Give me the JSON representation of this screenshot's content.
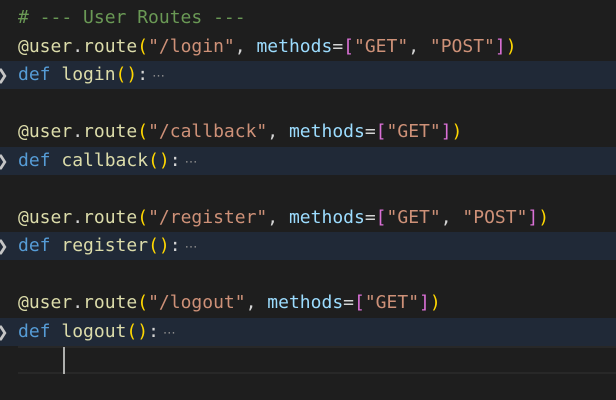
{
  "editor": {
    "language": "python",
    "colors": {
      "background": "#1e1e1e",
      "folded_line_background": "#202937",
      "comment": "#6a9955",
      "decorator": "#dcdcaa",
      "keyword": "#569cd6",
      "string": "#ce9178",
      "parameter": "#9cdcfe",
      "bracket_level1": "#ffd700",
      "bracket_level2": "#da70d6"
    },
    "fold_icon": "chevron-right-icon",
    "fold_placeholder": "⋯",
    "lines": [
      {
        "kind": "comment",
        "tokens": [
          {
            "t": "# --- User Routes ---",
            "c": "tk-comment"
          }
        ]
      },
      {
        "kind": "decorator",
        "tokens": [
          {
            "t": "@user",
            "c": "tk-deco"
          },
          {
            "t": ".",
            "c": "tk-plain"
          },
          {
            "t": "route",
            "c": "tk-deco"
          },
          {
            "t": "(",
            "c": "tk-br1"
          },
          {
            "t": "\"/login\"",
            "c": "tk-str"
          },
          {
            "t": ", ",
            "c": "tk-plain"
          },
          {
            "t": "methods",
            "c": "tk-param"
          },
          {
            "t": "=",
            "c": "tk-plain"
          },
          {
            "t": "[",
            "c": "tk-br2"
          },
          {
            "t": "\"GET\"",
            "c": "tk-str"
          },
          {
            "t": ", ",
            "c": "tk-plain"
          },
          {
            "t": "\"POST\"",
            "c": "tk-str"
          },
          {
            "t": "]",
            "c": "tk-br2"
          },
          {
            "t": ")",
            "c": "tk-br1"
          }
        ]
      },
      {
        "kind": "def",
        "folded": true,
        "tokens": [
          {
            "t": "def",
            "c": "tk-kw"
          },
          {
            "t": " ",
            "c": "tk-plain"
          },
          {
            "t": "login",
            "c": "tk-fn"
          },
          {
            "t": "()",
            "c": "tk-br1"
          },
          {
            "t": ":",
            "c": "tk-plain"
          }
        ]
      },
      {
        "kind": "blank",
        "tokens": []
      },
      {
        "kind": "decorator",
        "tokens": [
          {
            "t": "@user",
            "c": "tk-deco"
          },
          {
            "t": ".",
            "c": "tk-plain"
          },
          {
            "t": "route",
            "c": "tk-deco"
          },
          {
            "t": "(",
            "c": "tk-br1"
          },
          {
            "t": "\"/callback\"",
            "c": "tk-str"
          },
          {
            "t": ", ",
            "c": "tk-plain"
          },
          {
            "t": "methods",
            "c": "tk-param"
          },
          {
            "t": "=",
            "c": "tk-plain"
          },
          {
            "t": "[",
            "c": "tk-br2"
          },
          {
            "t": "\"GET\"",
            "c": "tk-str"
          },
          {
            "t": "]",
            "c": "tk-br2"
          },
          {
            "t": ")",
            "c": "tk-br1"
          }
        ]
      },
      {
        "kind": "def",
        "folded": true,
        "tokens": [
          {
            "t": "def",
            "c": "tk-kw"
          },
          {
            "t": " ",
            "c": "tk-plain"
          },
          {
            "t": "callback",
            "c": "tk-fn"
          },
          {
            "t": "()",
            "c": "tk-br1"
          },
          {
            "t": ":",
            "c": "tk-plain"
          }
        ]
      },
      {
        "kind": "blank",
        "tokens": []
      },
      {
        "kind": "decorator",
        "tokens": [
          {
            "t": "@user",
            "c": "tk-deco"
          },
          {
            "t": ".",
            "c": "tk-plain"
          },
          {
            "t": "route",
            "c": "tk-deco"
          },
          {
            "t": "(",
            "c": "tk-br1"
          },
          {
            "t": "\"/register\"",
            "c": "tk-str"
          },
          {
            "t": ", ",
            "c": "tk-plain"
          },
          {
            "t": "methods",
            "c": "tk-param"
          },
          {
            "t": "=",
            "c": "tk-plain"
          },
          {
            "t": "[",
            "c": "tk-br2"
          },
          {
            "t": "\"GET\"",
            "c": "tk-str"
          },
          {
            "t": ", ",
            "c": "tk-plain"
          },
          {
            "t": "\"POST\"",
            "c": "tk-str"
          },
          {
            "t": "]",
            "c": "tk-br2"
          },
          {
            "t": ")",
            "c": "tk-br1"
          }
        ]
      },
      {
        "kind": "def",
        "folded": true,
        "tokens": [
          {
            "t": "def",
            "c": "tk-kw"
          },
          {
            "t": " ",
            "c": "tk-plain"
          },
          {
            "t": "register",
            "c": "tk-fn"
          },
          {
            "t": "()",
            "c": "tk-br1"
          },
          {
            "t": ":",
            "c": "tk-plain"
          }
        ]
      },
      {
        "kind": "blank",
        "tokens": []
      },
      {
        "kind": "decorator",
        "tokens": [
          {
            "t": "@user",
            "c": "tk-deco"
          },
          {
            "t": ".",
            "c": "tk-plain"
          },
          {
            "t": "route",
            "c": "tk-deco"
          },
          {
            "t": "(",
            "c": "tk-br1"
          },
          {
            "t": "\"/logout\"",
            "c": "tk-str"
          },
          {
            "t": ", ",
            "c": "tk-plain"
          },
          {
            "t": "methods",
            "c": "tk-param"
          },
          {
            "t": "=",
            "c": "tk-plain"
          },
          {
            "t": "[",
            "c": "tk-br2"
          },
          {
            "t": "\"GET\"",
            "c": "tk-str"
          },
          {
            "t": "]",
            "c": "tk-br2"
          },
          {
            "t": ")",
            "c": "tk-br1"
          }
        ]
      },
      {
        "kind": "def",
        "folded": true,
        "tokens": [
          {
            "t": "def",
            "c": "tk-kw"
          },
          {
            "t": " ",
            "c": "tk-plain"
          },
          {
            "t": "logout",
            "c": "tk-fn"
          },
          {
            "t": "()",
            "c": "tk-br1"
          },
          {
            "t": ":",
            "c": "tk-plain"
          }
        ]
      },
      {
        "kind": "cursor",
        "tokens": []
      }
    ]
  }
}
